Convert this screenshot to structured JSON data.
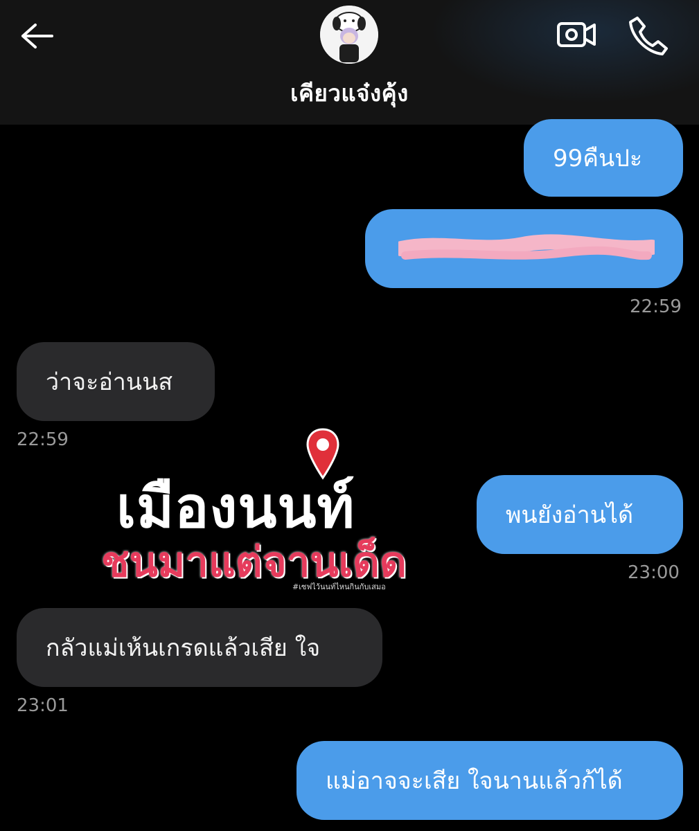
{
  "header": {
    "contact_name": "เคียวแจ๋งคุ้ง",
    "back_icon": "arrow-left-icon",
    "video_icon": "video-camera-icon",
    "call_icon": "phone-icon"
  },
  "messages": [
    {
      "side": "out",
      "text": "99คืนปะ"
    },
    {
      "side": "out",
      "text": "",
      "redacted": true,
      "timestamp": "22:59"
    },
    {
      "side": "in",
      "text": "ว่าจะอ่านนส",
      "timestamp": "22:59"
    },
    {
      "side": "out",
      "text": "พนยังอ่านได้",
      "timestamp": "23:00"
    },
    {
      "side": "in",
      "text": "กลัวแม่เห้นเกรดแล้วเสีย ใจ",
      "timestamp": "23:01"
    },
    {
      "side": "out",
      "text": "แม่อาจจะเสีย ใจนานแล้วก้ได้"
    }
  ],
  "watermark": {
    "line1": "เมืองนนท์",
    "line2": "ชนมาแต่จานเด็ด",
    "line3": "#เซฟไว้นนท์ไหนกินกับเสมอ"
  },
  "colors": {
    "outgoing_bubble": "#4b9cea",
    "incoming_bubble": "#2a2a2c",
    "header_bg": "#141414",
    "background": "#000000",
    "timestamp": "#9a9a9a",
    "watermark_red": "#e63b5c"
  }
}
